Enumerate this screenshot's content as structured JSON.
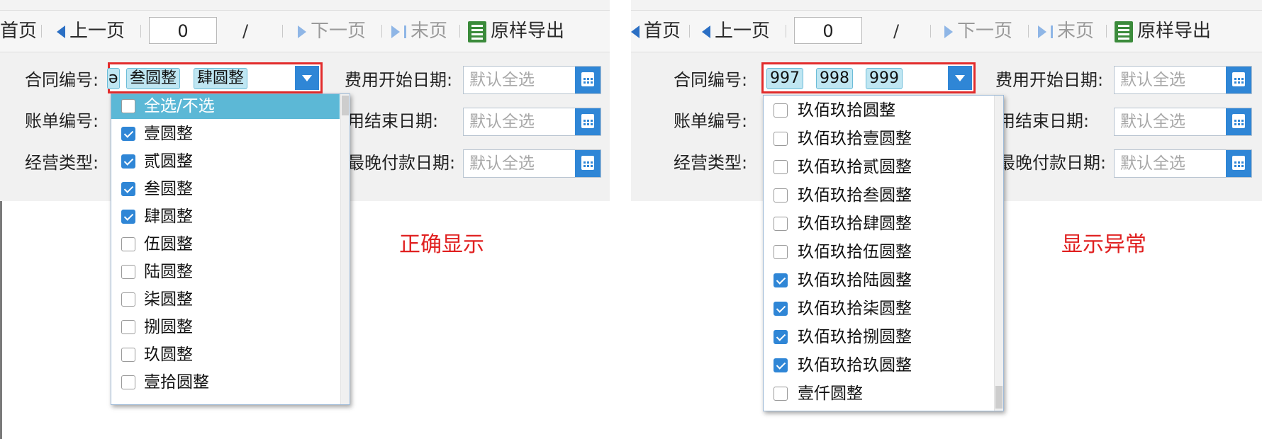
{
  "toolbar": {
    "first_page": "首页",
    "prev_page": "上一页",
    "page_value": "0",
    "page_sep": "/",
    "next_page": "下一页",
    "last_page": "末页",
    "export": "原样导出"
  },
  "form": {
    "contract_label": "合同编号:",
    "bill_label": "账单编号:",
    "business_label": "经营类型:",
    "start_label": "费用开始日期:",
    "end_label": "用结束日期:",
    "latest_label": "最晚付款日期:",
    "date_placeholder": "默认全选"
  },
  "left_panel": {
    "caption": "正确显示",
    "tags": [
      "ə",
      "叁圆整",
      "肆圆整"
    ],
    "options": [
      {
        "label": "全选/不选",
        "checked": false,
        "highlight": true
      },
      {
        "label": "壹圆整",
        "checked": true
      },
      {
        "label": "贰圆整",
        "checked": true
      },
      {
        "label": "叁圆整",
        "checked": true
      },
      {
        "label": "肆圆整",
        "checked": true
      },
      {
        "label": "伍圆整",
        "checked": false
      },
      {
        "label": "陆圆整",
        "checked": false
      },
      {
        "label": "柒圆整",
        "checked": false
      },
      {
        "label": "捌圆整",
        "checked": false
      },
      {
        "label": "玖圆整",
        "checked": false
      },
      {
        "label": "壹拾圆整",
        "checked": false
      }
    ]
  },
  "right_panel": {
    "caption": "显示异常",
    "tags": [
      "997",
      "998",
      "999"
    ],
    "options": [
      {
        "label": "玖佰玖拾圆整",
        "checked": false
      },
      {
        "label": "玖佰玖拾壹圆整",
        "checked": false
      },
      {
        "label": "玖佰玖拾贰圆整",
        "checked": false
      },
      {
        "label": "玖佰玖拾叁圆整",
        "checked": false
      },
      {
        "label": "玖佰玖拾肆圆整",
        "checked": false
      },
      {
        "label": "玖佰玖拾伍圆整",
        "checked": false
      },
      {
        "label": "玖佰玖拾陆圆整",
        "checked": true
      },
      {
        "label": "玖佰玖拾柒圆整",
        "checked": true
      },
      {
        "label": "玖佰玖拾捌圆整",
        "checked": true
      },
      {
        "label": "玖佰玖拾玖圆整",
        "checked": true
      },
      {
        "label": "壹仟圆整",
        "checked": false
      }
    ]
  },
  "colors": {
    "accent_blue": "#2f86d6",
    "highlight": "#5cb8d6",
    "tag_bg": "#bfe6f2",
    "red": "#e22c2c"
  }
}
